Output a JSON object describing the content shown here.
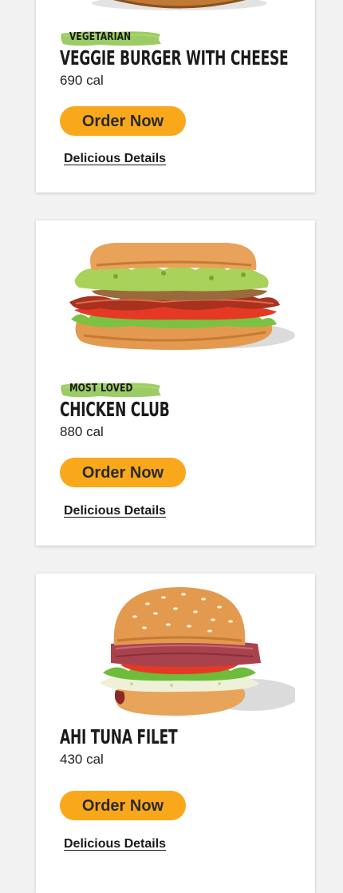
{
  "menu_items": [
    {
      "badge": "VEGETARIAN",
      "name": "VEGGIE BURGER WITH CHEESE",
      "calories": "690 cal",
      "order_label": "Order Now",
      "details_label": "Delicious Details"
    },
    {
      "badge": "MOST LOVED",
      "name": "CHICKEN CLUB",
      "calories": "880 cal",
      "order_label": "Order Now",
      "details_label": "Delicious Details"
    },
    {
      "name": "AHI TUNA FILET",
      "calories": "430 cal",
      "order_label": "Order Now",
      "details_label": "Delicious Details"
    }
  ],
  "colors": {
    "page_background": "#f2f2f2",
    "card_background": "#ffffff",
    "order_button": "#f9a81b",
    "badge_green": "#8bc34a",
    "text": "#1b1b1b"
  }
}
